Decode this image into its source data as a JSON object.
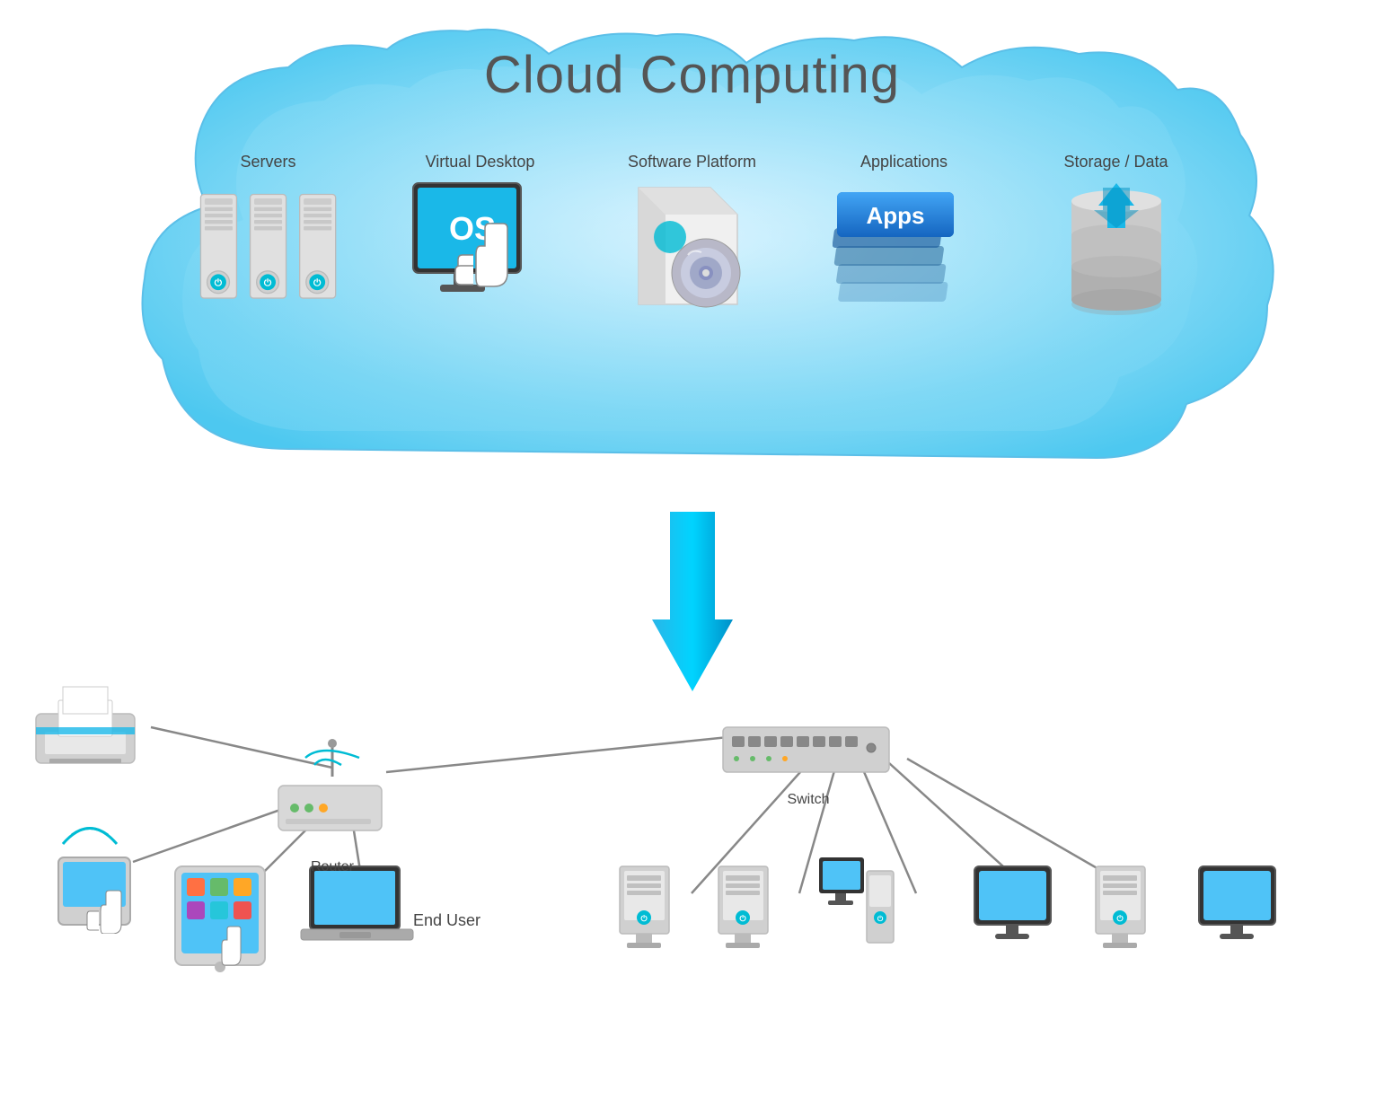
{
  "diagram": {
    "title": "Cloud Computing",
    "cloud": {
      "items": [
        {
          "id": "servers",
          "label": "Servers"
        },
        {
          "id": "virtual-desktop",
          "label": "Virtual Desktop"
        },
        {
          "id": "software-platform",
          "label": "Software Platform"
        },
        {
          "id": "applications",
          "label": "Applications"
        },
        {
          "id": "storage-data",
          "label": "Storage / Data"
        }
      ]
    },
    "bottom": {
      "router_label": "Router",
      "switch_label": "Switch",
      "end_user_label": "End User"
    }
  }
}
